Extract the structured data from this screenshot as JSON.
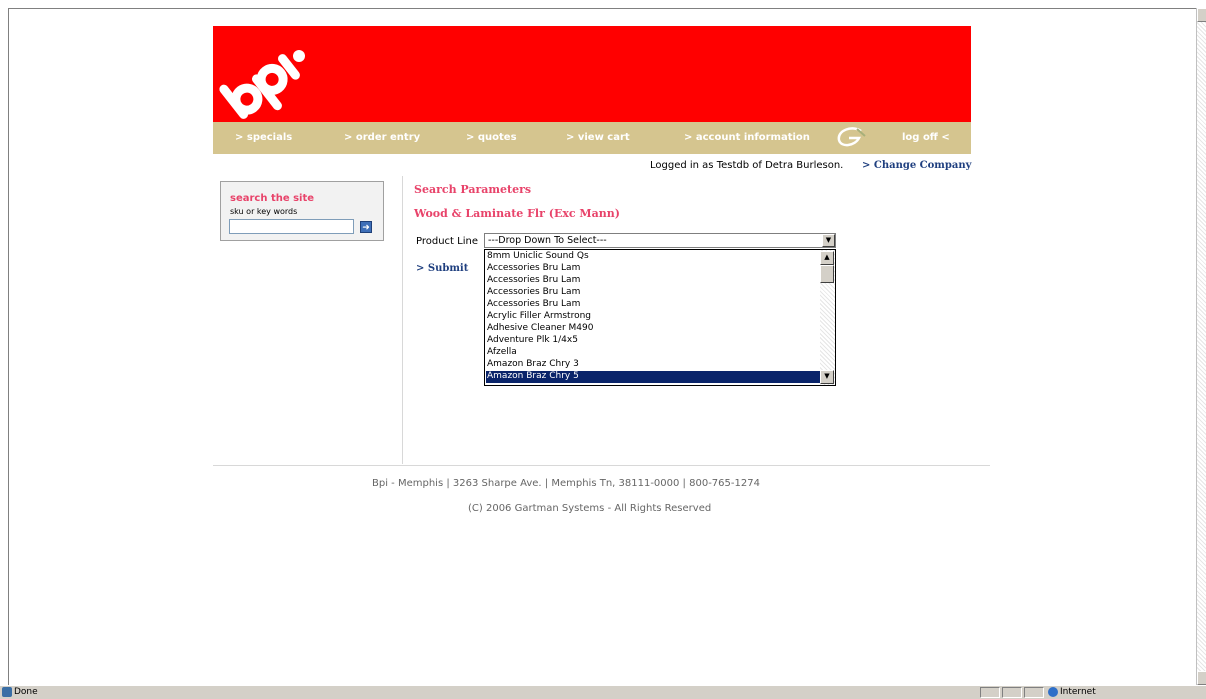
{
  "header": {
    "logo_text": "bpi",
    "nav": [
      {
        "label": "> specials"
      },
      {
        "label": "> order entry"
      },
      {
        "label": "> quotes"
      },
      {
        "label": "> view cart"
      },
      {
        "label": "> account information"
      },
      {
        "label": "log off <"
      }
    ],
    "brand_color": "#ff0000",
    "nav_color": "#d5c58f"
  },
  "login": {
    "text": "Logged in as Testdb of Detra Burleson.",
    "change_company": "> Change Company"
  },
  "search": {
    "title": "search the site",
    "subtitle": "sku or key words",
    "value": "",
    "go_icon": "arrow-right-icon"
  },
  "main": {
    "params_title": "Search Parameters",
    "category": "Wood & Laminate Flr (Exc Mann)",
    "product_line_label": "Product Line",
    "product_line_selected": "---Drop Down To Select---",
    "submit": "> Submit",
    "product_line_options": [
      "8mm Uniclic Sound Qs",
      "Accessories Bru Lam",
      "Accessories Bru Lam",
      "Accessories Bru Lam",
      "Accessories Bru Lam",
      "Acrylic Filler Armstrong",
      "Adhesive Cleaner M490",
      "Adventure Plk 1/4x5",
      "Afzella",
      "Amazon Braz Chry 3",
      "Amazon Braz Chry 5"
    ],
    "highlighted_option": "Amazon Braz Chry 5"
  },
  "footer": {
    "address": "Bpi - Memphis  |  3263 Sharpe Ave.  |  Memphis Tn, 38111-0000  |  800-765-1274",
    "copyright": "(C) 2006 Gartman Systems - All Rights Reserved"
  },
  "statusbar": {
    "status": "Done",
    "zone": "Internet"
  }
}
